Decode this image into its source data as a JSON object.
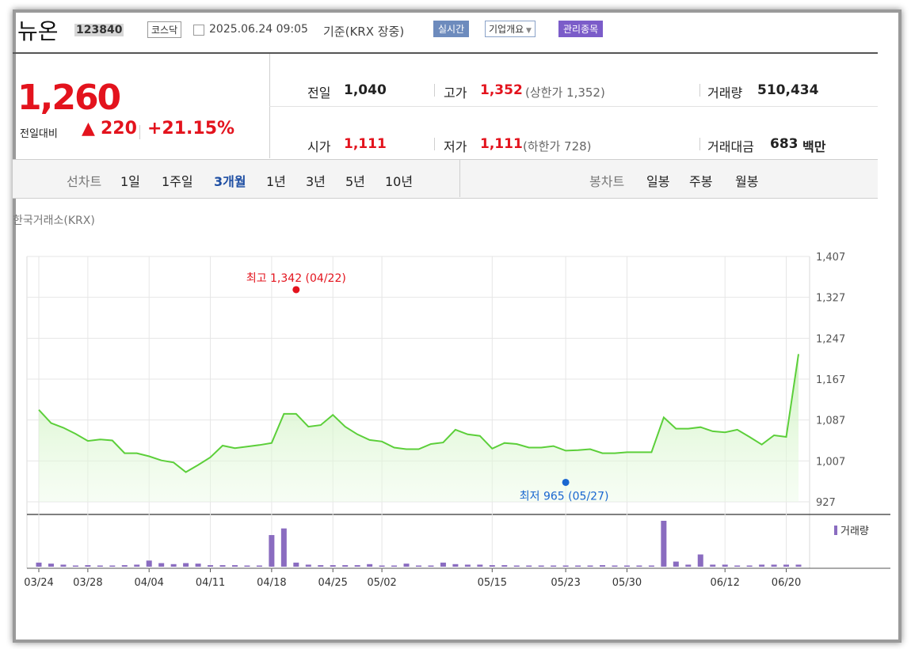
{
  "header": {
    "stock_name": "뉴온",
    "stock_code": "123840",
    "market": "코스닥",
    "datetime": "2025.06.24 09:05",
    "basis": "기준(KRX 장중)",
    "realtime_label": "실시간",
    "company_info_label": "기업개요",
    "management_label": "관리종목"
  },
  "price": {
    "current": "1,260",
    "change_label": "전일대비",
    "change_arrow": "▲",
    "change": "220",
    "change_rate": "+21.15%"
  },
  "summary": {
    "prev_label": "전일",
    "prev_value": "1,040",
    "high_label": "고가",
    "high_value": "1,352",
    "upper_limit": "(상한가 1,352)",
    "volume_label": "거래량",
    "volume_value": "510,434",
    "open_label": "시가",
    "open_value": "1,111",
    "low_label": "저가",
    "low_value": "1,111",
    "lower_limit": "(하한가 728)",
    "amount_label": "거래대금",
    "amount_value": "683",
    "amount_unit": "백만"
  },
  "tabs": {
    "line_chart_label": "선차트",
    "periods": [
      "1일",
      "1주일",
      "3개월",
      "1년",
      "3년",
      "5년",
      "10년"
    ],
    "selected_period": "3개월",
    "candle_label": "봉차트",
    "candles": [
      "일봉",
      "주봉",
      "월봉"
    ]
  },
  "exchange_label": "한국거래소(KRX)",
  "colors": {
    "up": "#e3131d",
    "down": "#1a66d0",
    "line": "#5ccf3a",
    "volume": "#8a6cc0",
    "selected_tab": "#1f4fa3"
  },
  "chart_data": {
    "type": "line",
    "x_labels": [
      "03/24",
      "03/28",
      "04/04",
      "04/11",
      "04/18",
      "04/25",
      "05/02",
      "05/15",
      "05/23",
      "05/30",
      "06/12",
      "06/20"
    ],
    "ylim": [
      927,
      1407
    ],
    "y_ticks": [
      "1,407",
      "1,327",
      "1,247",
      "1,167",
      "1,087",
      "1,007",
      "927"
    ],
    "close": [
      1107,
      1081,
      1072,
      1060,
      1046,
      1049,
      1047,
      1022,
      1022,
      1016,
      1008,
      1004,
      985,
      999,
      1014,
      1037,
      1032,
      1035,
      1038,
      1042,
      1099,
      1099,
      1074,
      1077,
      1097,
      1074,
      1059,
      1048,
      1045,
      1033,
      1030,
      1030,
      1040,
      1043,
      1068,
      1059,
      1056,
      1031,
      1042,
      1040,
      1033,
      1033,
      1036,
      1027,
      1028,
      1030,
      1022,
      1022,
      1024,
      1024,
      1024,
      1092,
      1070,
      1070,
      1073,
      1065,
      1063,
      1068,
      1054,
      1039,
      1057,
      1054,
      1216
    ],
    "volume": [
      8,
      6,
      4,
      1,
      3,
      1,
      1,
      3,
      4,
      12,
      7,
      5,
      7,
      6,
      3,
      3,
      3,
      1,
      1,
      62,
      75,
      8,
      4,
      3,
      3,
      3,
      3,
      5,
      1,
      1,
      6,
      1,
      1,
      8,
      5,
      4,
      4,
      3,
      3,
      1,
      1,
      1,
      1,
      1,
      1,
      1,
      3,
      1,
      1,
      1,
      1,
      90,
      10,
      4,
      24,
      4,
      4,
      1,
      1,
      4,
      4,
      4,
      4
    ],
    "max_point": {
      "label": "최고 1,342 (04/22)",
      "value": 1342
    },
    "min_point": {
      "label": "최저 965 (05/27)",
      "value": 965
    },
    "volume_legend": "거래량"
  }
}
